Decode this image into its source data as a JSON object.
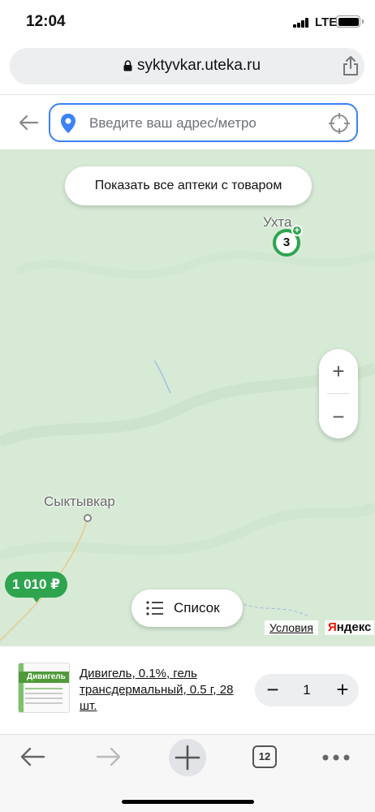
{
  "status_bar": {
    "time": "12:04",
    "network": "LTE"
  },
  "browser": {
    "url": "syktyvkar.uteka.ru",
    "tabs_count": "12"
  },
  "search": {
    "placeholder": "Введите ваш адрес/метро"
  },
  "map": {
    "show_all_label": "Показать все аптеки с товаром",
    "cities": {
      "ukhta": "Ухта",
      "syktyvkar": "Сыктывкар"
    },
    "cluster_count": "3",
    "price_pin": "1 010 ₽",
    "zoom_in": "+",
    "zoom_out": "−",
    "list_label": "Список",
    "terms_label": "Условия",
    "yandex_logo_first": "Я",
    "yandex_logo_rest": "ндекс",
    "colors": {
      "map_green": "#d7ead6",
      "accent_green": "#2ea44f",
      "search_border": "#3b82f6"
    }
  },
  "product": {
    "name": "Дивигель, 0.1%, гель трансдермальный, 0.5 г, 28 шт.",
    "image_brand": "Дивигель",
    "quantity": "1",
    "minus": "−",
    "plus": "+"
  },
  "icons": [
    "lock-icon",
    "share-icon",
    "back-arrow-icon",
    "location-pin-icon",
    "crosshair-icon",
    "list-icon",
    "forward-icon",
    "plus-icon",
    "tabs-icon",
    "more-icon"
  ]
}
